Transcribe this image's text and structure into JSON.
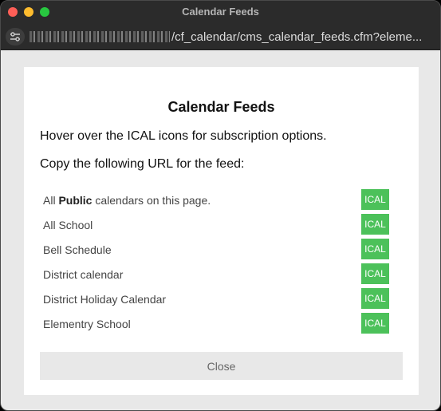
{
  "window": {
    "title": "Calendar Feeds"
  },
  "address_bar": {
    "url_visible": "/cf_calendar/cms_calendar_feeds.cfm?eleme..."
  },
  "dialog": {
    "title": "Calendar Feeds",
    "instruction_hover": "Hover over the ICAL icons for subscription options.",
    "instruction_copy": "Copy the following URL for the feed:",
    "all_public": {
      "prefix": "All ",
      "bold": "Public",
      "suffix": " calendars on this page.",
      "button": "ICAL"
    },
    "feeds": [
      {
        "label": "All School",
        "button": "ICAL"
      },
      {
        "label": "Bell Schedule",
        "button": "ICAL"
      },
      {
        "label": "District calendar",
        "button": "ICAL"
      },
      {
        "label": "District Holiday Calendar",
        "button": "ICAL"
      },
      {
        "label": "Elementry School",
        "button": "ICAL"
      }
    ],
    "close_label": "Close"
  },
  "colors": {
    "ical_button": "#4cc15a",
    "close_button_bg": "#e8e8e8",
    "traffic_close": "#fe5f57",
    "traffic_minimize": "#febc2e",
    "traffic_maximize": "#28c840"
  }
}
